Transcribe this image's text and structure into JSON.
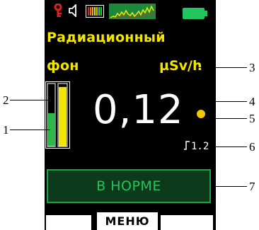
{
  "header": {
    "line1": "Радиационный",
    "line2": "фон",
    "unit": "µSv/h"
  },
  "status_bar": {
    "icons": [
      "key-icon",
      "speaker-icon",
      "signal-bars-icon",
      "spectrum-graph-icon",
      "battery-icon"
    ]
  },
  "reading": {
    "value": "0,12",
    "threshold": "1.2"
  },
  "bar_indicator": {
    "green_level": 0.53,
    "yellow_level": 0.95
  },
  "status": {
    "label": "В НОРМЕ"
  },
  "softkeys": {
    "center": "МЕНЮ"
  },
  "callouts": [
    "1",
    "2",
    "3",
    "4",
    "5",
    "6",
    "7"
  ],
  "colors": {
    "background": "#000000",
    "title_yellow": "#f2e600",
    "status_green": "#22c55e",
    "status_border": "#1aa34a",
    "indicator_dot": "#f2c600",
    "key_icon": "#e02020",
    "battery": "#22c55e"
  }
}
